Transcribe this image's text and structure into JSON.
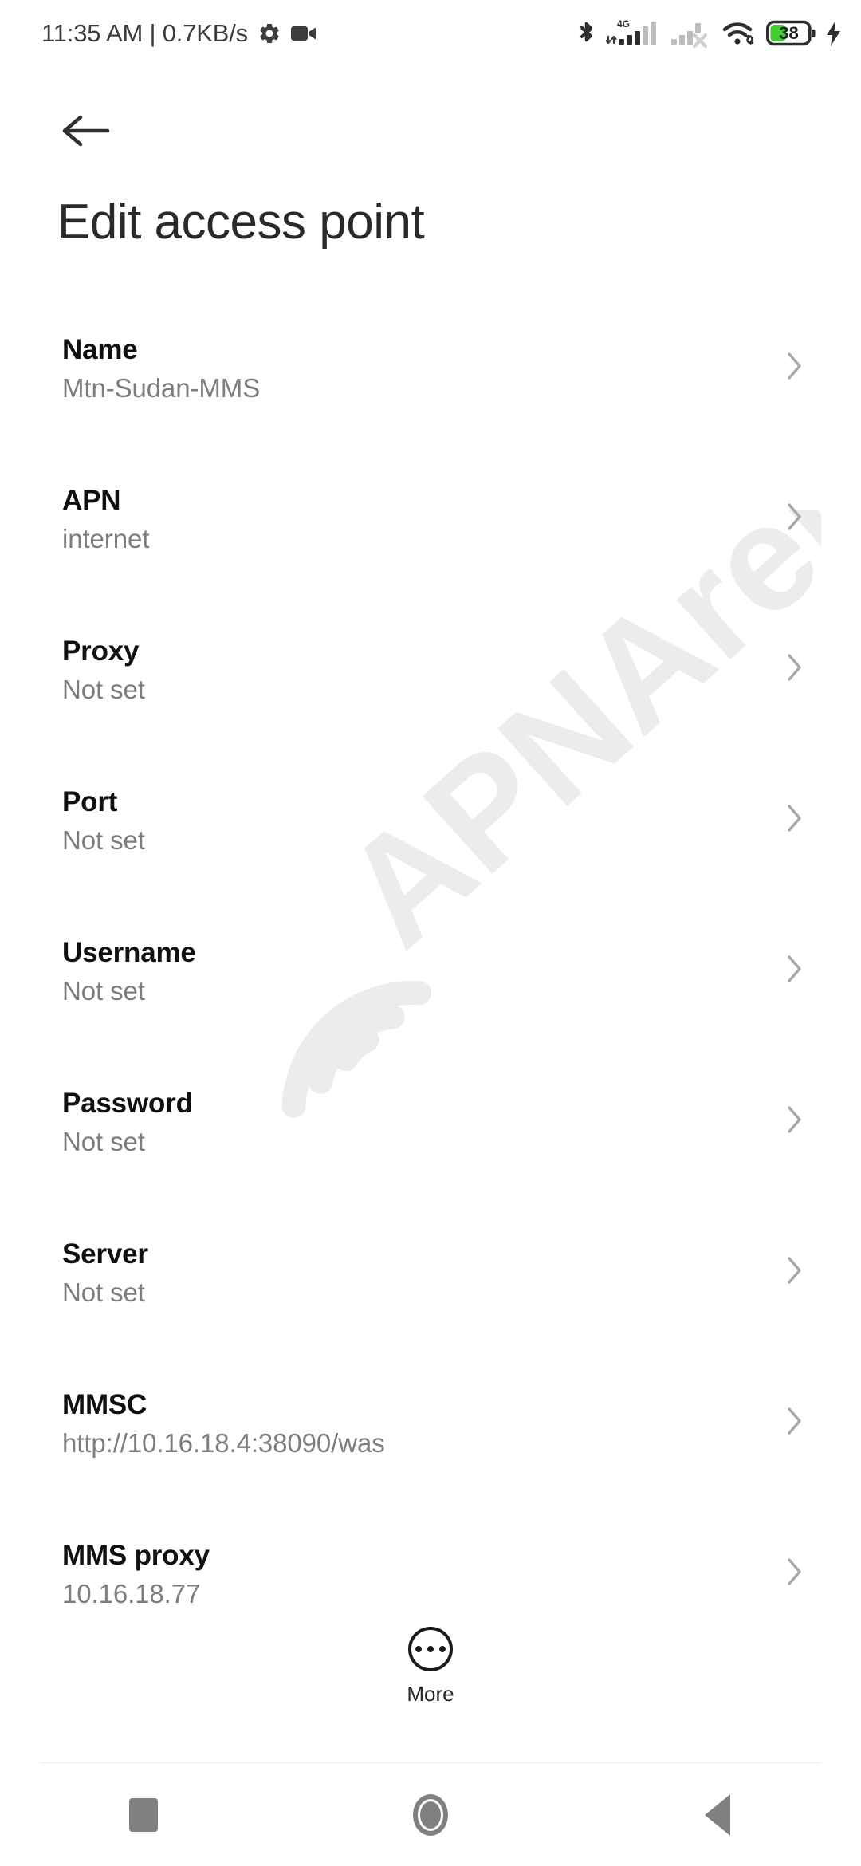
{
  "status_bar": {
    "clock": "11:35 AM | 0.7KB/s",
    "icons_left": [
      "gear-icon",
      "video-camera-icon"
    ],
    "icons_right": [
      "bluetooth-icon",
      "signal-4g-icon",
      "signal-sim2-no-service-icon",
      "wifi-icon",
      "battery-icon",
      "charging-bolt-icon"
    ],
    "network_label": "4G",
    "battery_percent": "38",
    "battery_color": "#3ecf2e",
    "charging": true
  },
  "header": {
    "back_icon": "arrow-left-icon",
    "title": "Edit access point"
  },
  "settings": {
    "chevron_icon": "chevron-right-icon",
    "rows": [
      {
        "title": "Name",
        "value": "Mtn-Sudan-MMS"
      },
      {
        "title": "APN",
        "value": "internet"
      },
      {
        "title": "Proxy",
        "value": "Not set"
      },
      {
        "title": "Port",
        "value": "Not set"
      },
      {
        "title": "Username",
        "value": "Not set"
      },
      {
        "title": "Password",
        "value": "Not set"
      },
      {
        "title": "Server",
        "value": "Not set"
      },
      {
        "title": "MMSC",
        "value": "http://10.16.18.4:38090/was"
      },
      {
        "title": "MMS proxy",
        "value": "10.16.18.77"
      }
    ]
  },
  "more_button": {
    "label": "More",
    "icon": "more-horizontal-circle-icon"
  },
  "nav_bar": {
    "recents_label": "Recents",
    "home_label": "Home",
    "back_label": "Back",
    "color": "#808080"
  },
  "watermark": {
    "text": "APNArena",
    "color": "#ececec"
  },
  "colors": {
    "background": "#ffffff",
    "title_text": "#2a2a2a",
    "row_title": "#101010",
    "row_value": "#7d7d7d",
    "chevron": "#a8a8a8",
    "divider": "#e8e8e8"
  }
}
